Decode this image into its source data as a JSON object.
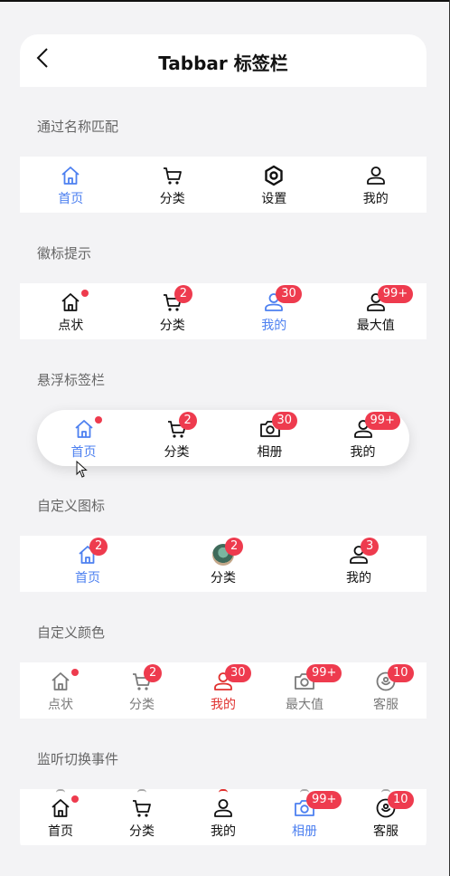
{
  "header": {
    "title": "Tabbar 标签栏"
  },
  "sections": [
    {
      "title": "通过名称匹配",
      "tabs": [
        {
          "label": "首页",
          "icon": "home-icon",
          "active": true
        },
        {
          "label": "分类",
          "icon": "cart-icon"
        },
        {
          "label": "设置",
          "icon": "settings-icon"
        },
        {
          "label": "我的",
          "icon": "user-icon"
        }
      ]
    },
    {
      "title": "徽标提示",
      "tabs": [
        {
          "label": "点状",
          "icon": "home-icon",
          "dot": true
        },
        {
          "label": "分类",
          "icon": "cart-icon",
          "badge": "2"
        },
        {
          "label": "我的",
          "icon": "user-icon",
          "badge": "30",
          "active": true
        },
        {
          "label": "最大值",
          "icon": "user-icon",
          "badge": "99+"
        }
      ]
    },
    {
      "title": "悬浮标签栏",
      "tabs": [
        {
          "label": "首页",
          "icon": "home-icon",
          "dot": true,
          "active": true
        },
        {
          "label": "分类",
          "icon": "cart-icon",
          "badge": "2"
        },
        {
          "label": "相册",
          "icon": "camera-icon",
          "badge": "30"
        },
        {
          "label": "我的",
          "icon": "user-icon",
          "badge": "99+"
        }
      ]
    },
    {
      "title": "自定义图标",
      "tabs": [
        {
          "label": "首页",
          "icon": "home-icon",
          "badge": "2",
          "active": true
        },
        {
          "label": "分类",
          "icon": "avatar",
          "badge": "2"
        },
        {
          "label": "我的",
          "icon": "user-icon",
          "badge": "3"
        }
      ]
    },
    {
      "title": "自定义颜色",
      "tabs": [
        {
          "label": "点状",
          "icon": "home-icon",
          "dot": true
        },
        {
          "label": "分类",
          "icon": "cart-icon",
          "badge": "2"
        },
        {
          "label": "我的",
          "icon": "user-icon",
          "badge": "30",
          "active": true
        },
        {
          "label": "最大值",
          "icon": "camera-icon",
          "badge": "99+"
        },
        {
          "label": "客服",
          "icon": "service-icon",
          "badge": "10"
        }
      ]
    },
    {
      "title": "监听切换事件",
      "tabs": [
        {
          "label": "首页",
          "icon": "home-icon",
          "dot": true
        },
        {
          "label": "分类",
          "icon": "cart-icon"
        },
        {
          "label": "我的",
          "icon": "user-icon"
        },
        {
          "label": "相册",
          "icon": "camera-icon",
          "badge": "99+",
          "active": true
        },
        {
          "label": "客服",
          "icon": "service-icon",
          "badge": "10"
        }
      ]
    }
  ],
  "colors": {
    "active_blue": "#4d80f0",
    "active_red": "#e0312f",
    "inactive_gray": "#7a7a7a",
    "text": "#111111",
    "badge": "#ee3b4e"
  }
}
